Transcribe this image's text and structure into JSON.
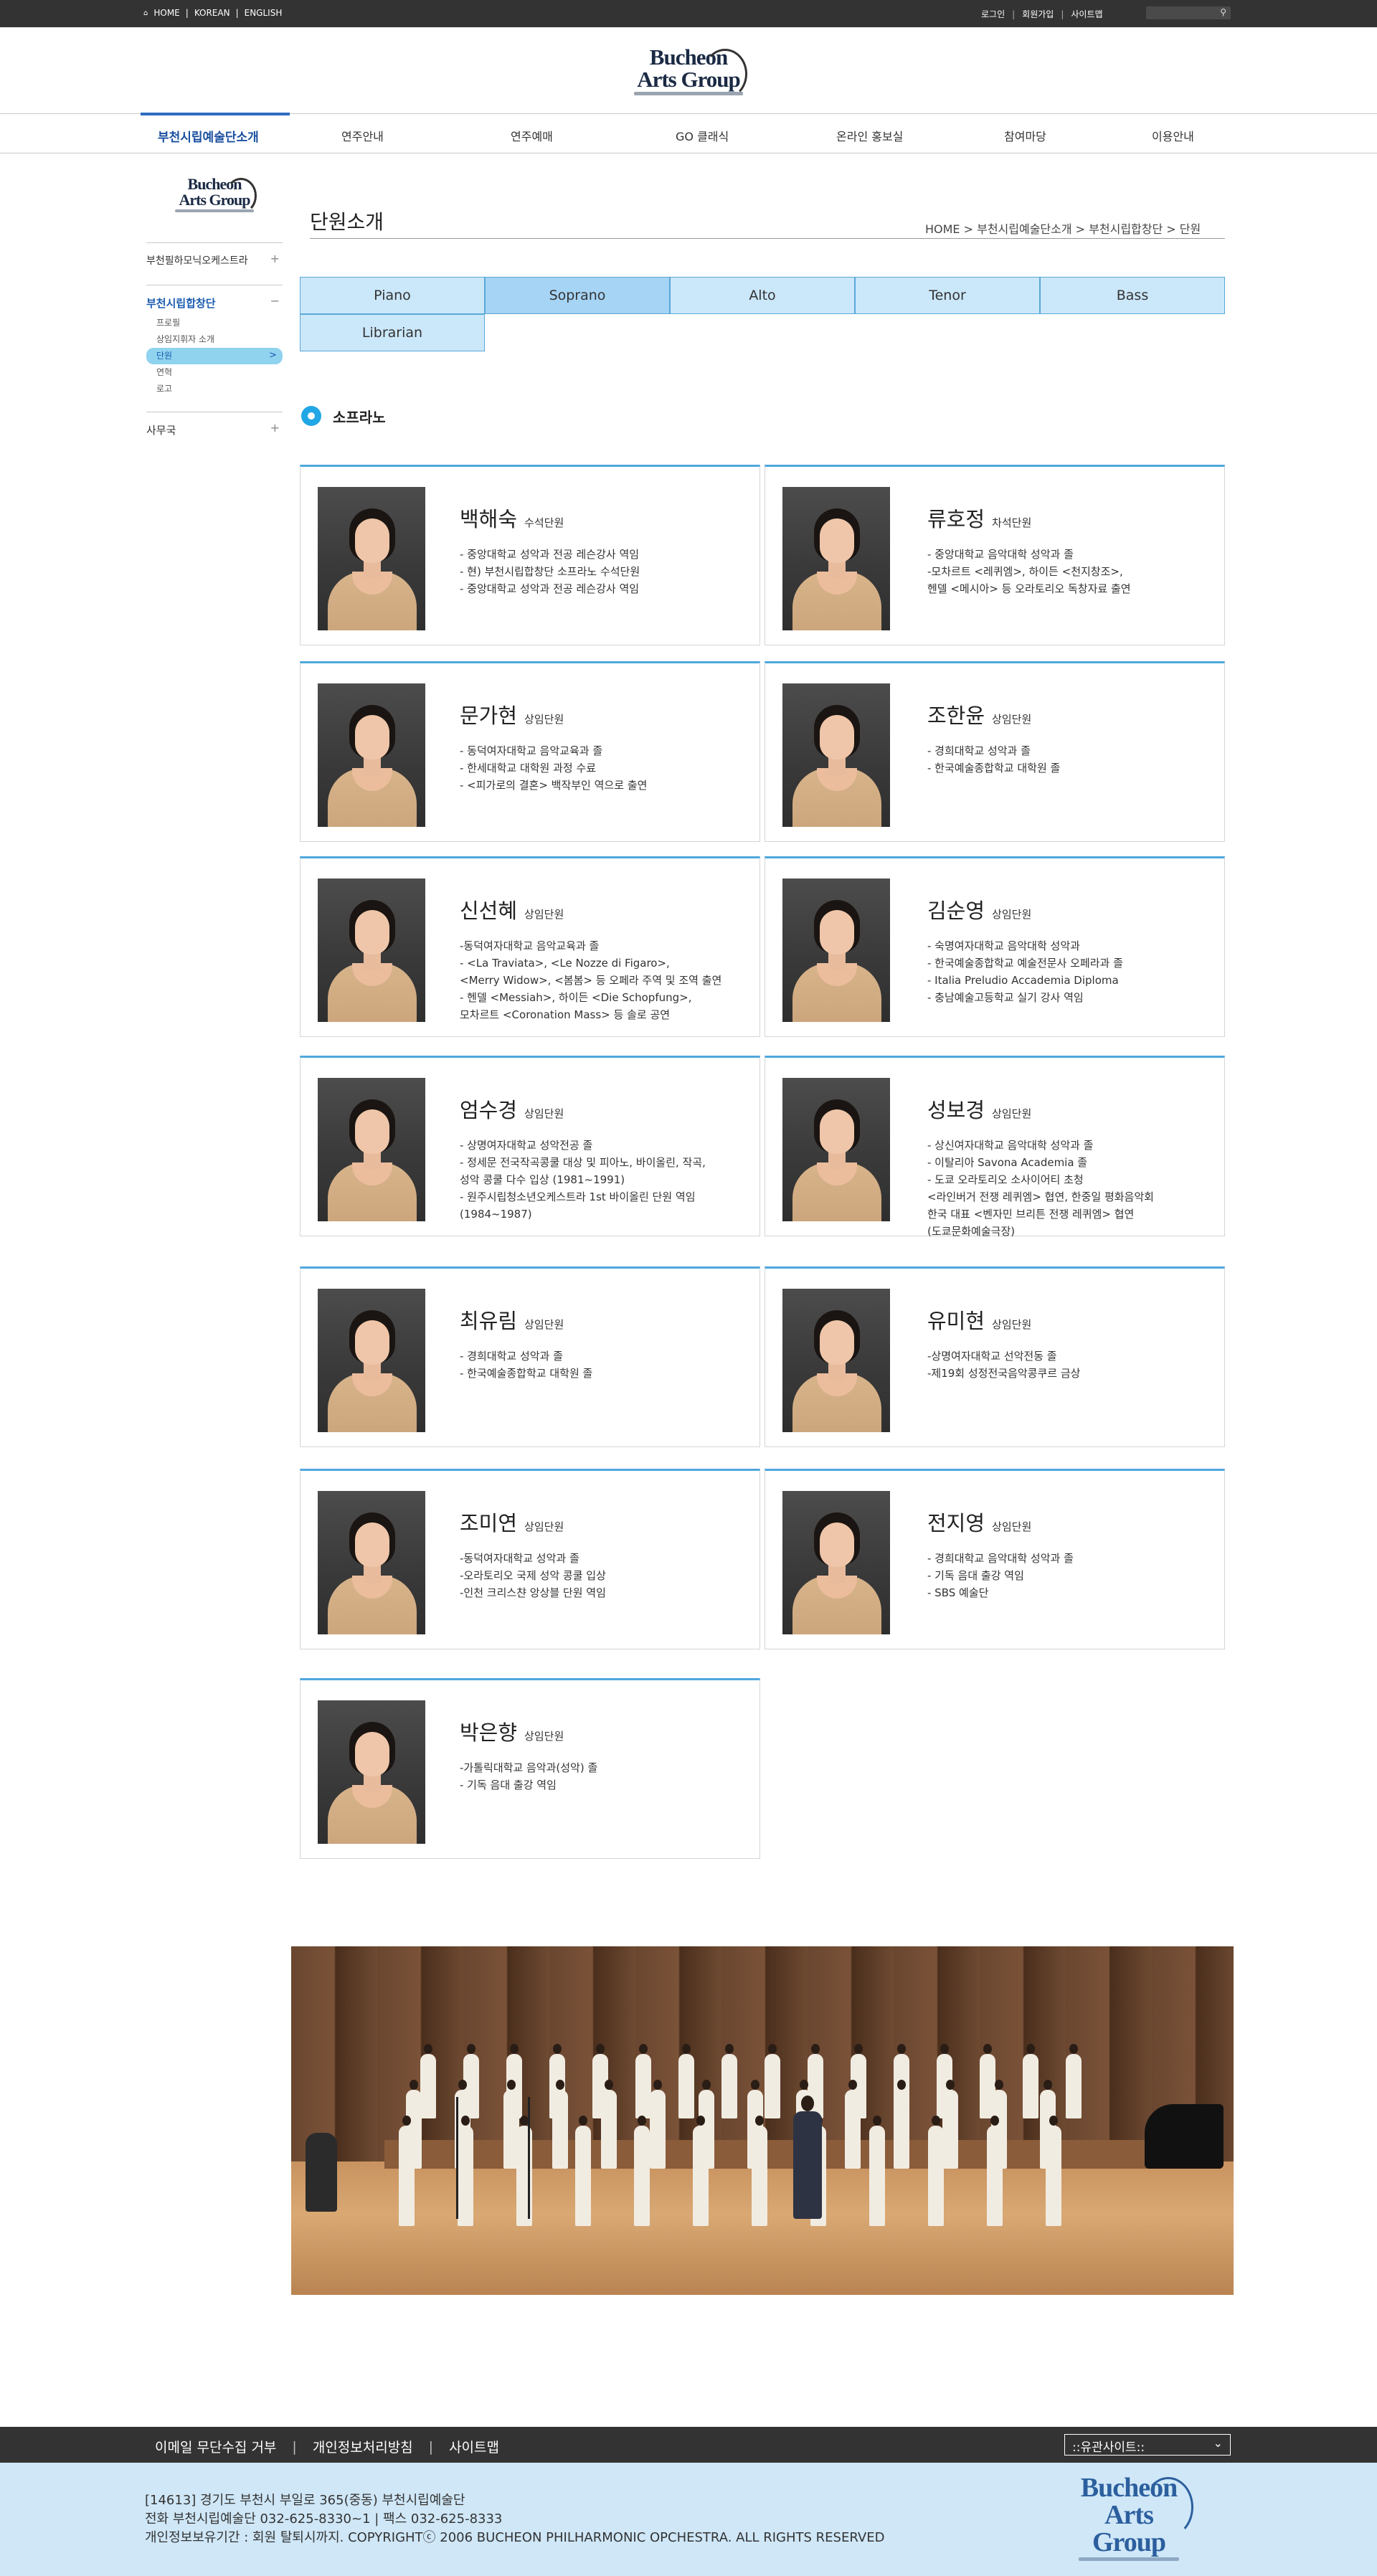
{
  "topbar": {
    "links": [
      "HOME",
      "KOREAN",
      "ENGLISH"
    ],
    "util": [
      "로그인",
      "회원가입",
      "사이트맵"
    ]
  },
  "logo": {
    "line1": "Bucheon",
    "line2": "Arts Group"
  },
  "nav": {
    "items": [
      "부천시립예술단소개",
      "연주안내",
      "연주예매",
      "GO 클래식",
      "온라인 홍보실",
      "참여마당",
      "이용안내"
    ],
    "active_index": 0
  },
  "sidebar": {
    "groups": [
      {
        "title": "부천필하모닉오케스트라",
        "toggle": "+",
        "subs": []
      },
      {
        "title": "부천시립합창단",
        "toggle": "−",
        "subs": [
          "프로필",
          "상임지휘자 소개",
          "단원",
          "연혁",
          "로고"
        ]
      },
      {
        "title": "사무국",
        "toggle": "+",
        "subs": []
      }
    ],
    "current_sub": "단원",
    "current_chevron": ">"
  },
  "content": {
    "title": "단원소개",
    "breadcrumb": "HOME > 부천시립예술단소개 > 부천시립합창단 > 단원",
    "tabs": [
      "Piano",
      "Soprano",
      "Alto",
      "Tenor",
      "Bass",
      "Librarian"
    ],
    "active_tab": "Soprano",
    "section_title": "소프라노"
  },
  "members": [
    {
      "name": "백해숙",
      "role": "수석단원",
      "desc": "- 중앙대학교 성악과 전공 레슨강사 역임\n- 현) 부천시립합창단 소프라노 수석단원\n- 중앙대학교 성악과 전공 레슨강사 역임"
    },
    {
      "name": "류호정",
      "role": "차석단원",
      "desc": "- 중앙대학교 음악대학 성악과 졸\n-모차르트 <레퀴엠>, 하이든 <천지창조>,\n  헨델 <메시아> 등 오라토리오 독창자료 출연"
    },
    {
      "name": "문가현",
      "role": "상임단원",
      "desc": "- 동덕여자대학교 음악교육과 졸\n- 한세대학교 대학원 과정 수료\n- <피가로의 결혼> 백작부인 역으로 출연"
    },
    {
      "name": "조한윤",
      "role": "상임단원",
      "desc": "- 경희대학교 성악과 졸\n- 한국예술종합학교 대학원 졸"
    },
    {
      "name": "신선혜",
      "role": "상임단원",
      "desc": "-동덕여자대학교 음악교육과 졸\n- <La Traviata>, <Le Nozze di Figaro>,\n  <Merry Widow>, <봄봄> 등 오페라 주역 및 조역 출연\n- 헨델 <Messiah>, 하이든 <Die Schopfung>,\n  모차르트 <Coronation Mass> 등 솔로 공연"
    },
    {
      "name": "김순영",
      "role": "상임단원",
      "desc": "- 숙명여자대학교 음악대학 성악과\n- 한국예술종합학교 예술전문사 오페라과 졸\n- Italia Preludio Accademia Diploma\n- 충남예술고등학교 실기 강사 역임"
    },
    {
      "name": "엄수경",
      "role": "상임단원",
      "desc": "- 상명여자대학교 성악전공 졸\n- 정세문 전국작곡콩쿨 대상 및 피아노, 바이올린, 작곡,\n  성악 콩쿨 다수 입상 (1981~1991)\n- 원주시립청소년오케스트라 1st 바이올린 단원 역임\n  (1984~1987)"
    },
    {
      "name": "성보경",
      "role": "상임단원",
      "desc": "- 상신여자대학교 음악대학 성악과 졸\n- 이탈리아 Savona Academia 졸\n- 도쿄 오라토리오 소사이어티 초청\n  <라인버거 전쟁 레퀴엠> 협연, 한중일 평화음악회\n  한국 대표 <벤자민 브리튼 전쟁 레퀴엠> 협연\n  (도쿄문화예술극장)"
    },
    {
      "name": "최유림",
      "role": "상임단원",
      "desc": "- 경희대학교 성악과 졸\n- 한국예술종합학교 대학원 졸"
    },
    {
      "name": "유미현",
      "role": "상임단원",
      "desc": "-상명여자대학교 선악전동 졸\n-제19회 성정전국음악콩쿠르 금상"
    },
    {
      "name": "조미연",
      "role": "상임단원",
      "desc": "-동덕여자대학교 성악과 졸\n-오라토리오 국제 성악 콩쿨 입상\n-인천 크리스챤 앙상블 단원 역임"
    },
    {
      "name": "전지영",
      "role": "상임단원",
      "desc": "- 경희대학교 음악대학 성악과 졸\n- 기독 음대 출강 역임\n- SBS 예술단"
    },
    {
      "name": "박은향",
      "role": "상임단원",
      "desc": "-가톨릭대학교 음악과(성악) 졸\n- 기독 음대 출강 역임"
    }
  ],
  "footer": {
    "links": [
      "이메일 무단수집 거부",
      "개인정보처리방침",
      "사이트맵"
    ],
    "related_select": "::유관사이트::",
    "address": "[14613] 경기도 부천시 부일로 365(중동) 부천시립예술단\n전화 부천시립예술단 032-625-8330~1 | 팩스 032-625-8333\n개인정보보유기간 : 회원 탈퇴시까지. COPYRIGHTⓒ 2006 BUCHEON PHILHARMONIC OPCHESTRA. ALL RIGHTS RESERVED"
  }
}
